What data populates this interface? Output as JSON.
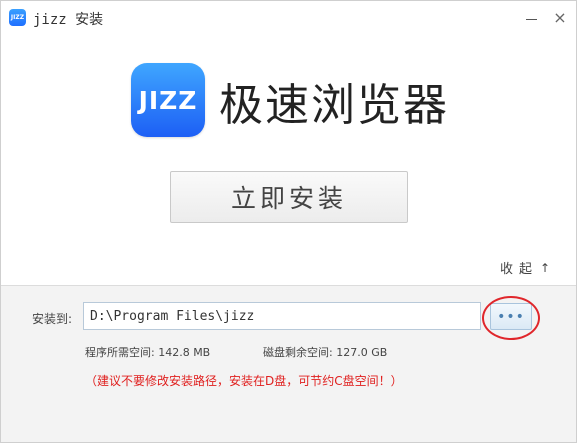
{
  "window": {
    "title": "jizz 安装",
    "app_icon_text": "JIZZ",
    "minimize_label": "—",
    "close_label": "×"
  },
  "brand": {
    "logo_text": "JIZZ",
    "name": "极速浏览器",
    "colors": {
      "logo_top": "#3fa6ff",
      "logo_bottom": "#1d5ff5"
    }
  },
  "install": {
    "button_label": "立即安装"
  },
  "collapse": {
    "label": "收起",
    "icon": "arrow-up-icon",
    "glyph": "↑"
  },
  "path": {
    "label": "安装到:",
    "value": "D:\\Program Files\\jizz",
    "browse_label": "•••"
  },
  "space": {
    "required": "程序所需空间: 142.8 MB",
    "free": "磁盘剩余空间: 127.0 GB"
  },
  "warning": {
    "text": "（建议不要修改安装路径，安装在D盘，可节约C盘空间！）",
    "color": "#e0201f"
  },
  "highlight": {
    "color": "#e0262b"
  }
}
